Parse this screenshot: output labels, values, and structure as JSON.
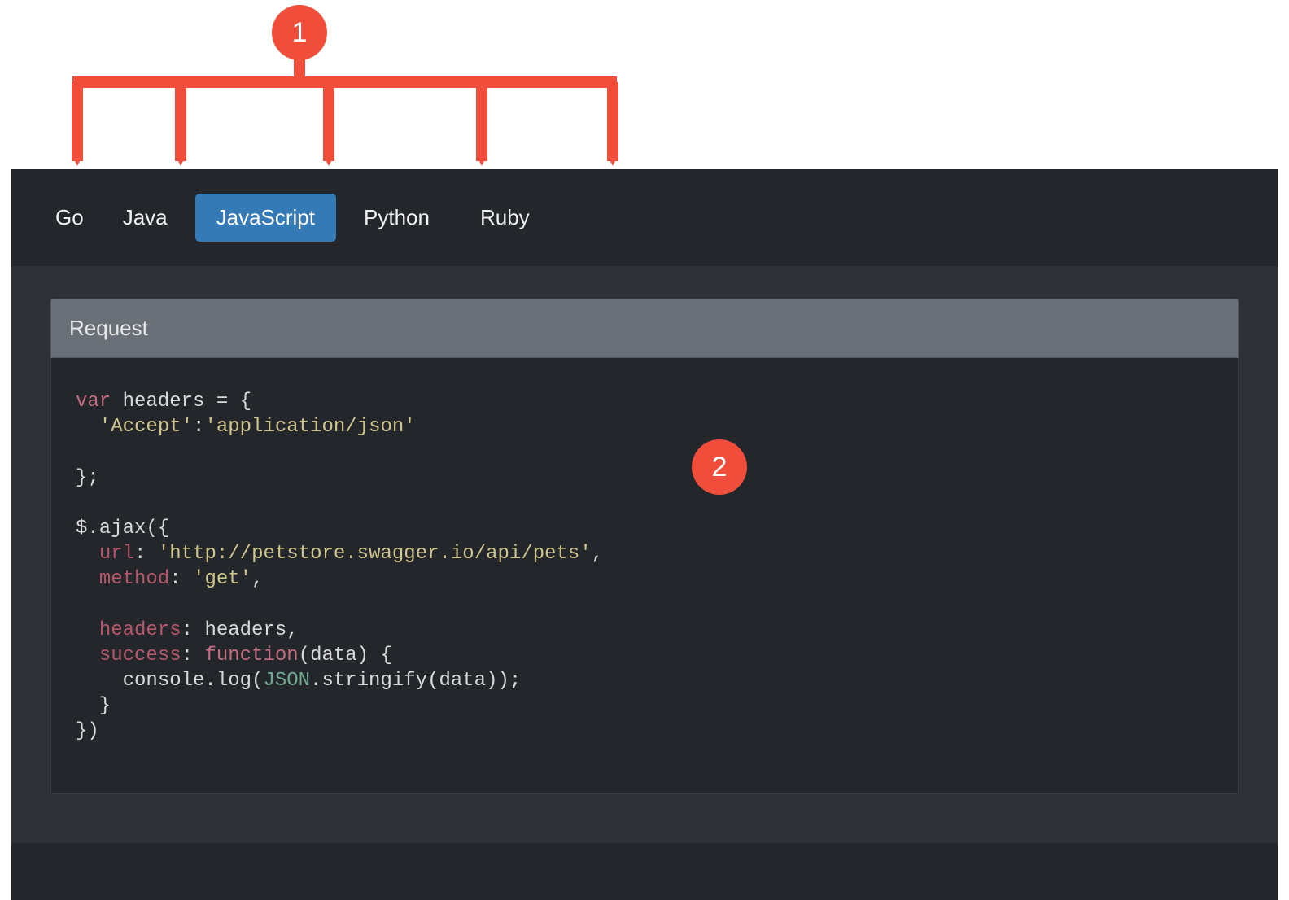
{
  "annotations": {
    "badge1": "1",
    "badge2": "2",
    "color": "#F04E3B"
  },
  "tabs": [
    {
      "label": "Go",
      "active": false
    },
    {
      "label": "Java",
      "active": false
    },
    {
      "label": "JavaScript",
      "active": true
    },
    {
      "label": "Python",
      "active": false
    },
    {
      "label": "Ruby",
      "active": false
    }
  ],
  "section": {
    "title": "Request"
  },
  "code": {
    "tokens": [
      {
        "t": "kw",
        "v": "var"
      },
      {
        "t": "plain",
        "v": " headers = {\n  "
      },
      {
        "t": "str",
        "v": "'Accept'"
      },
      {
        "t": "plain",
        "v": ":"
      },
      {
        "t": "str",
        "v": "'application/json'"
      },
      {
        "t": "plain",
        "v": "\n\n};\n\n$.ajax({\n  "
      },
      {
        "t": "attr",
        "v": "url"
      },
      {
        "t": "plain",
        "v": ": "
      },
      {
        "t": "str",
        "v": "'http://petstore.swagger.io/api/pets'"
      },
      {
        "t": "plain",
        "v": ",\n  "
      },
      {
        "t": "attr",
        "v": "method"
      },
      {
        "t": "plain",
        "v": ": "
      },
      {
        "t": "str",
        "v": "'get'"
      },
      {
        "t": "plain",
        "v": ",\n\n  "
      },
      {
        "t": "attr",
        "v": "headers"
      },
      {
        "t": "plain",
        "v": ": headers,\n  "
      },
      {
        "t": "attr",
        "v": "success"
      },
      {
        "t": "plain",
        "v": ": "
      },
      {
        "t": "kw",
        "v": "function"
      },
      {
        "t": "plain",
        "v": "(data) {\n    console.log("
      },
      {
        "t": "builtin",
        "v": "JSON"
      },
      {
        "t": "plain",
        "v": ".stringify(data));\n  }\n})"
      }
    ]
  }
}
